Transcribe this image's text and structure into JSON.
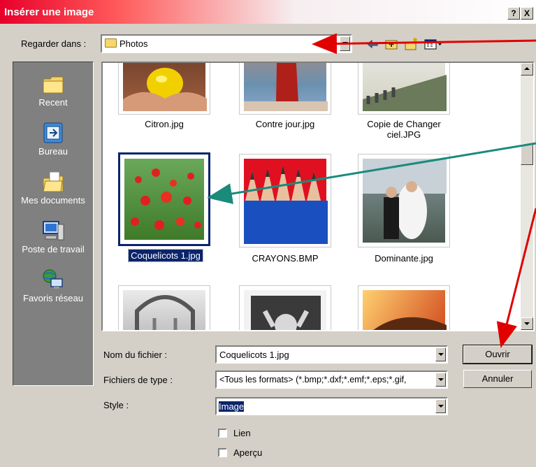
{
  "dialog": {
    "title": "Insérer une image",
    "help_button": "?",
    "close_button": "X"
  },
  "lookin": {
    "label": "Regarder dans :",
    "value": "Photos"
  },
  "toolbar": {
    "back_icon": "back-arrow-icon",
    "up_icon": "folder-up-icon",
    "new_folder_icon": "new-folder-icon",
    "views_icon": "views-menu-icon"
  },
  "places": [
    {
      "label": "Recent",
      "icon": "recent-folder-icon"
    },
    {
      "label": "Bureau",
      "icon": "desktop-icon"
    },
    {
      "label": "Mes documents",
      "icon": "my-documents-icon"
    },
    {
      "label": "Poste de travail",
      "icon": "my-computer-icon"
    },
    {
      "label": "Favoris réseau",
      "icon": "network-places-icon"
    }
  ],
  "files": [
    {
      "name": "Citron.jpg",
      "selected": false
    },
    {
      "name": "Contre jour.jpg",
      "selected": false
    },
    {
      "name": "Copie de Changer ciel.JPG",
      "selected": false
    },
    {
      "name": "Coquelicots 1.jpg",
      "selected": true
    },
    {
      "name": "CRAYONS.BMP",
      "selected": false
    },
    {
      "name": "Dominante.jpg",
      "selected": false
    }
  ],
  "form": {
    "filename_label": "Nom du fichier :",
    "filename_value": "Coquelicots 1.jpg",
    "filetype_label": "Fichiers de type :",
    "filetype_value": "<Tous les formats> (*.bmp;*.dxf;*.emf;*.eps;*.gif,",
    "style_label": "Style :",
    "style_value": "Image",
    "link_label": "Lien",
    "preview_label": "Aperçu"
  },
  "buttons": {
    "open": "Ouvrir",
    "cancel": "Annuler"
  },
  "colors": {
    "annotation_red": "#e00000",
    "annotation_teal": "#1a8a7a",
    "selection": "#0a246a"
  }
}
